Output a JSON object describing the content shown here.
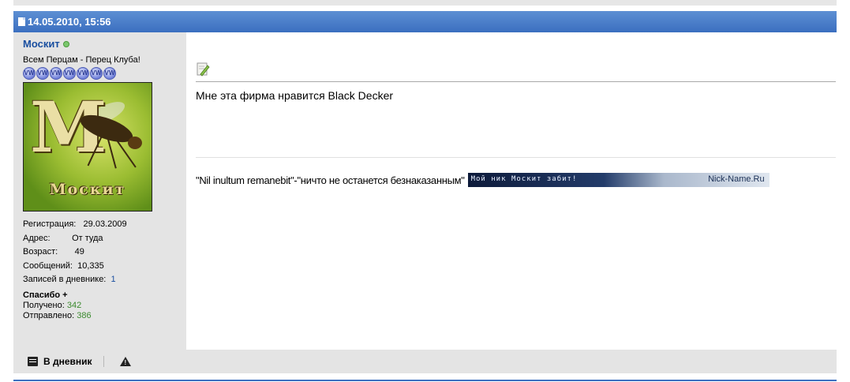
{
  "post": {
    "date": "14.05.2010, 15:56",
    "message": "Мне эта фирма нравится Black Decker",
    "signature_text": "\"Nil inultum remanebit\"-\"ничто не останется безнаказанным\"",
    "signature_banner_left": "Мой ник Москит забит!",
    "signature_banner_right": "Nick-Name.Ru"
  },
  "user": {
    "name": "Москит",
    "title": "Всем Перцам - Перец Клуба!",
    "avatar_text": "Москит",
    "avatar_letter": "М",
    "rank_icons": 7,
    "stats": {
      "registration_label": "Регистрация:",
      "registration_value": "29.03.2009",
      "address_label": "Адрес:",
      "address_value": "От туда",
      "age_label": "Возраст:",
      "age_value": "49",
      "messages_label": "Сообщений:",
      "messages_value": "10,335",
      "diary_label": "Записей в дневнике:",
      "diary_value": "1"
    },
    "thanks": {
      "title": "Спасибо +",
      "received_label": "Получено:",
      "received_value": "342",
      "sent_label": "Отправлено:",
      "sent_value": "386"
    }
  },
  "footer": {
    "diary_button": "В дневник"
  }
}
